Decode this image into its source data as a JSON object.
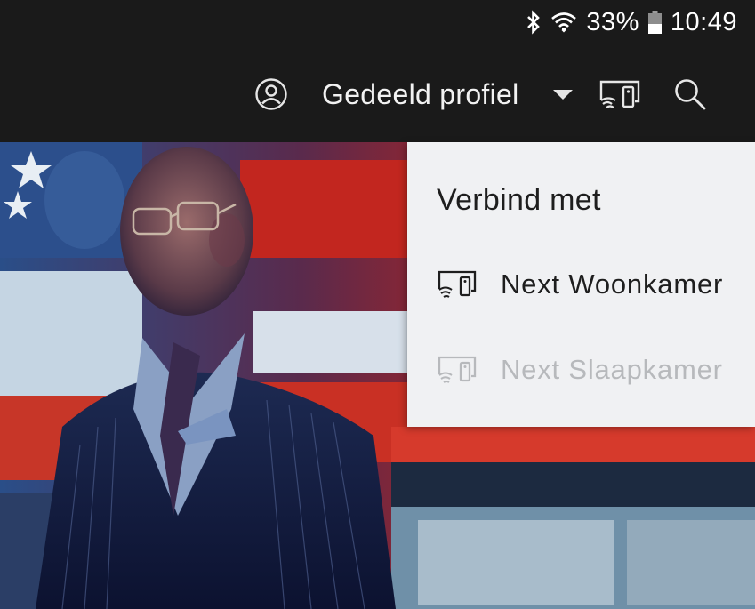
{
  "status_bar": {
    "battery": "33%",
    "time": "10:49",
    "icons": [
      "bluetooth-icon",
      "wifi-icon",
      "battery-icon"
    ]
  },
  "header": {
    "profile_label": "Gedeeld profiel",
    "icons": [
      "profile-icon",
      "dropdown-arrow-icon",
      "cast-device-icon",
      "search-icon"
    ]
  },
  "connect_menu": {
    "title": "Verbind met",
    "devices": [
      {
        "label": "Next Woonkamer",
        "enabled": true
      },
      {
        "label": "Next Slaapkamer",
        "enabled": false
      }
    ]
  },
  "colors": {
    "header_bg": "#1a1a1a",
    "menu_bg": "#f0f1f3",
    "menu_text": "#1e1e1e",
    "menu_text_disabled": "#b7b9bc"
  }
}
